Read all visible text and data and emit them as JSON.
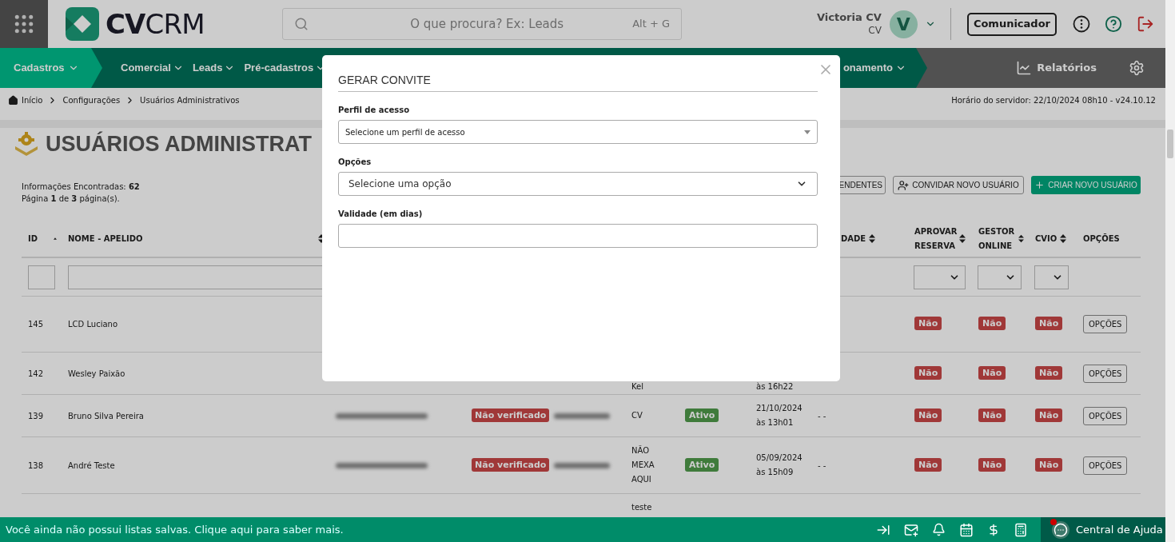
{
  "header": {
    "logo_bold": "CV",
    "logo_light": "CRM",
    "search_placeholder": "O que procura? Ex: Leads",
    "shortcut": "Alt + G",
    "user_name": "Victoria CV",
    "user_role": "CV",
    "avatar_initial": "V",
    "communicator": "Comunicador"
  },
  "nav": {
    "items": [
      {
        "label": "Cadastros",
        "selected": true
      },
      {
        "label": "Comercial",
        "selected": false
      },
      {
        "label": "Leads",
        "selected": false
      },
      {
        "label": "Pré-cadastros",
        "selected": false
      }
    ],
    "cut_item": "onamento",
    "reports": "Relatórios"
  },
  "breadcrumb": [
    "Início",
    "Configurações",
    "Usuários Administrativos"
  ],
  "server_time": "Horário do servidor: 22/10/2024 08h10 - v24.10.12",
  "page_title": "USUÁRIOS ADMINISTRAT",
  "summary": [
    "Informações Encontradas: **62**",
    "Página **1** de **3** página(s)."
  ],
  "actions": [
    {
      "label": "ENDENTES",
      "kind": "outline"
    },
    {
      "label": "CONVIDAR NOVO USUÁRIO",
      "kind": "invite"
    },
    {
      "label": "CRIAR NOVO USUÁRIO",
      "kind": "primary"
    }
  ],
  "table": {
    "columns": [
      {
        "label": "ID",
        "sortable": true,
        "sorted": true
      },
      {
        "label": "NOME - APELIDO",
        "sortable": true,
        "sorted": false
      },
      {
        "label": "DADE",
        "sortable": true,
        "sorted": false
      },
      {
        "label": "APROVAR RESERVA",
        "sortable": true,
        "sorted": false
      },
      {
        "label": "GESTOR ONLINE",
        "sortable": true,
        "sorted": false
      },
      {
        "label": "CVIO",
        "sortable": true,
        "sorted": false
      },
      {
        "label": "OPÇÕES",
        "sortable": false
      }
    ],
    "rows": [
      {
        "id": "145",
        "name": "LCD Luciano",
        "approve": "Não",
        "manager": "Não",
        "cvio": "Não",
        "options": "OPÇÕES"
      },
      {
        "id": "142",
        "name": "Wesley Paixão",
        "company": "Kel",
        "time": "às 16h22",
        "approve": "Não",
        "manager": "Não",
        "cvio": "Não",
        "options": "OPÇÕES"
      },
      {
        "id": "139",
        "name": "Bruno Silva Pereira",
        "redacted": true,
        "verification": "Não verificado",
        "company": "CV",
        "status": "Ativo",
        "date": "21/10/2024",
        "time": "às 13h01",
        "last_activity": "- -",
        "approve": "Não",
        "manager": "Não",
        "cvio": "Não",
        "options": "OPÇÕES"
      },
      {
        "id": "138",
        "name": "André Teste",
        "redacted": true,
        "verification": "Não verificado",
        "company": "NÃO MEXA AQUI",
        "status": "Ativo",
        "date": "05/09/2024",
        "time": "às 15h09",
        "last_activity": "- -",
        "approve": "Não",
        "manager": "Não",
        "cvio": "Não",
        "options": "OPÇÕES"
      },
      {
        "company": "teste"
      }
    ]
  },
  "modal": {
    "title": "GERAR CONVITE",
    "fields": [
      {
        "label": "Perfil de acesso",
        "kind": "select2",
        "placeholder": "Selecione um perfil de acesso"
      },
      {
        "label": "Opções",
        "kind": "select",
        "value": "Selecione uma opção"
      },
      {
        "label": "Validade (em dias)",
        "kind": "input"
      }
    ]
  },
  "bottom_bar": {
    "message": "Você ainda não possui listas salvas. Clique aqui para saber mais.",
    "help": "Central de Ajuda",
    "notification": true
  }
}
